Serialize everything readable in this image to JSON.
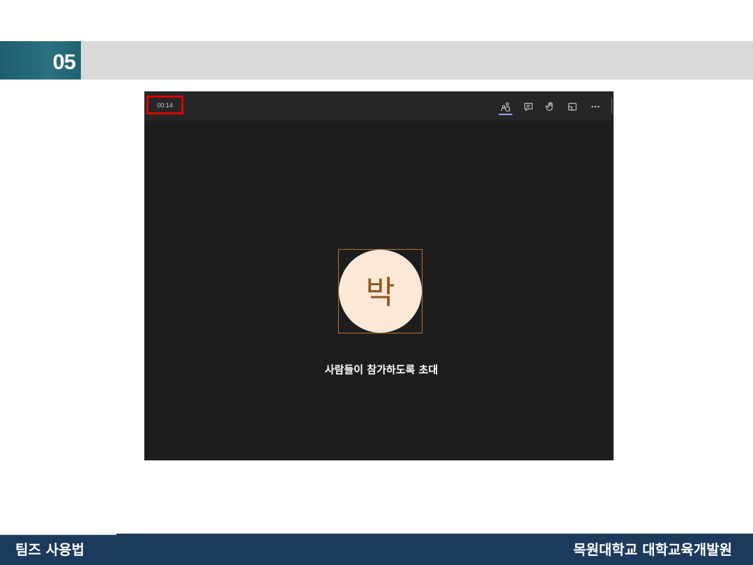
{
  "slide": {
    "section_number": "05",
    "accent_color": "#1f6272",
    "header_bar_color": "#d9d9d9"
  },
  "teams": {
    "timer": "00:14",
    "toolbar": [
      {
        "icon": "people-icon",
        "label": "참가자",
        "active": true
      },
      {
        "icon": "chat-icon",
        "label": "채팅",
        "active": false
      },
      {
        "icon": "raise-hand-icon",
        "label": "손 들기",
        "active": false
      },
      {
        "icon": "share-screen-icon",
        "label": "콘텐츠 공유",
        "active": false
      },
      {
        "icon": "more-icon",
        "label": "더 보기",
        "active": false
      }
    ],
    "avatar_initial": "박",
    "avatar_bg": "#fce8d7",
    "avatar_text_color": "#8e5a22",
    "invite_text": "사람들이 참가하도록 초대"
  },
  "footer": {
    "left_text": "팀즈 사용법",
    "right_text": "목원대학교 대학교육개발원",
    "bg_color": "#1c3a5c"
  }
}
